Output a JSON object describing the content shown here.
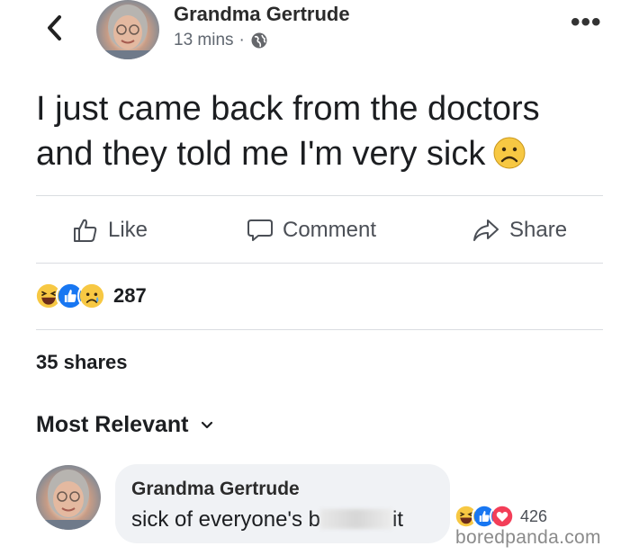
{
  "post": {
    "author": "Grandma Gertrude",
    "time": "13 mins",
    "separator": "·",
    "text_line1": "I just came back from the doctors",
    "text_line2": "and they told me I'm very sick"
  },
  "actions": {
    "like": "Like",
    "comment": "Comment",
    "share": "Share"
  },
  "reactions": {
    "icons": [
      "haha-icon",
      "like-icon",
      "sad-icon"
    ],
    "count": "287"
  },
  "shares": "35 shares",
  "sort": {
    "label": "Most Relevant"
  },
  "comment": {
    "author": "Grandma Gertrude",
    "text_before": "sick of everyone's b",
    "text_after": "it",
    "reactions": [
      "haha-icon",
      "like-icon",
      "love-icon"
    ],
    "reaction_count": "426"
  },
  "watermark": "boredpanda.com",
  "colors": {
    "like_blue": "#1877f2",
    "love_red": "#f33e58",
    "emoji_yellow": "#f7c843",
    "text": "#1c1e21",
    "secondary": "#606770"
  }
}
